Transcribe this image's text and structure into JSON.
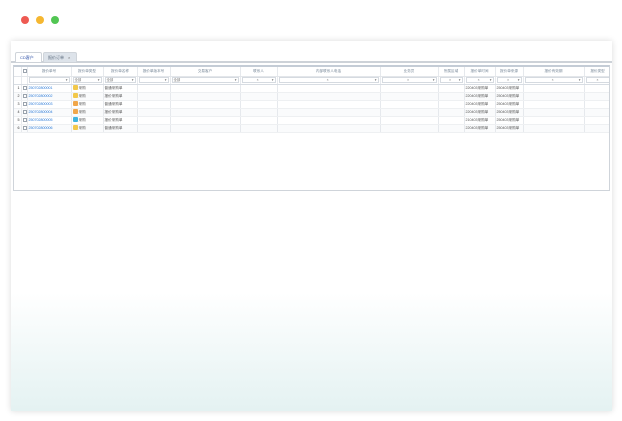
{
  "tabs": [
    {
      "label": "CD客户"
    },
    {
      "label": "报价订单",
      "close": "×"
    }
  ],
  "columns": [
    "",
    "",
    "报价单号",
    "报价单类型",
    "报价单名称",
    "报价单版本号",
    "交易客户",
    "联系人",
    "内部联系人电话",
    "业务员",
    "所属区域",
    "报价单时间",
    "报价单来源",
    "报价有效期",
    "报价类型"
  ],
  "filters": [
    {
      "value": "",
      "clear": "",
      "dropdown": "▾"
    },
    {
      "value": "全部",
      "clear": "",
      "dropdown": "▾"
    },
    {
      "value": "全部",
      "clear": "",
      "dropdown": "▾"
    },
    {
      "value": "",
      "clear": "",
      "dropdown": "▾"
    },
    {
      "value": "全部",
      "clear": "",
      "dropdown": "▾"
    },
    {
      "value": "",
      "clear": "×",
      "dropdown": "▾"
    },
    {
      "value": "",
      "clear": "×",
      "dropdown": "▾"
    },
    {
      "value": "",
      "clear": "×",
      "dropdown": "▾"
    },
    {
      "value": "",
      "clear": "×",
      "dropdown": "▾"
    },
    {
      "value": "",
      "clear": "×",
      "dropdown": "▾"
    },
    {
      "value": "",
      "clear": "×",
      "dropdown": "▾"
    },
    {
      "value": "",
      "clear": "×",
      "dropdown": "▾"
    },
    {
      "value": "",
      "clear": "×",
      "dropdown": ""
    }
  ],
  "rows": [
    {
      "num": "1",
      "code": "250702800001",
      "type": "采购",
      "type_color": "#f2c84b",
      "name": "普通采购单",
      "time": "220403采购单",
      "source": "250403采购单"
    },
    {
      "num": "2",
      "code": "250702800002",
      "type": "采购",
      "type_color": "#f2c84b",
      "name": "报价采购单",
      "time": "220403采购单",
      "source": "250403采购单"
    },
    {
      "num": "3",
      "code": "250702800003",
      "type": "采购",
      "type_color": "#f0a64a",
      "name": "普通采购单",
      "time": "220403采购单",
      "source": "250403采购单"
    },
    {
      "num": "4",
      "code": "250702800004",
      "type": "采购",
      "type_color": "#f0a64a",
      "name": "报价采购单",
      "time": "220403采购单",
      "source": "250403采购单"
    },
    {
      "num": "5",
      "code": "250702800005",
      "type": "采购",
      "type_color": "#3fb4e0",
      "name": "报价采购单",
      "time": "210403采购单",
      "source": "250403采购单"
    },
    {
      "num": "6",
      "code": "250702800006",
      "type": "采购",
      "type_color": "#f2c84b",
      "name": "普通采购单",
      "time": "220403采购单",
      "source": "250403采购单"
    }
  ]
}
